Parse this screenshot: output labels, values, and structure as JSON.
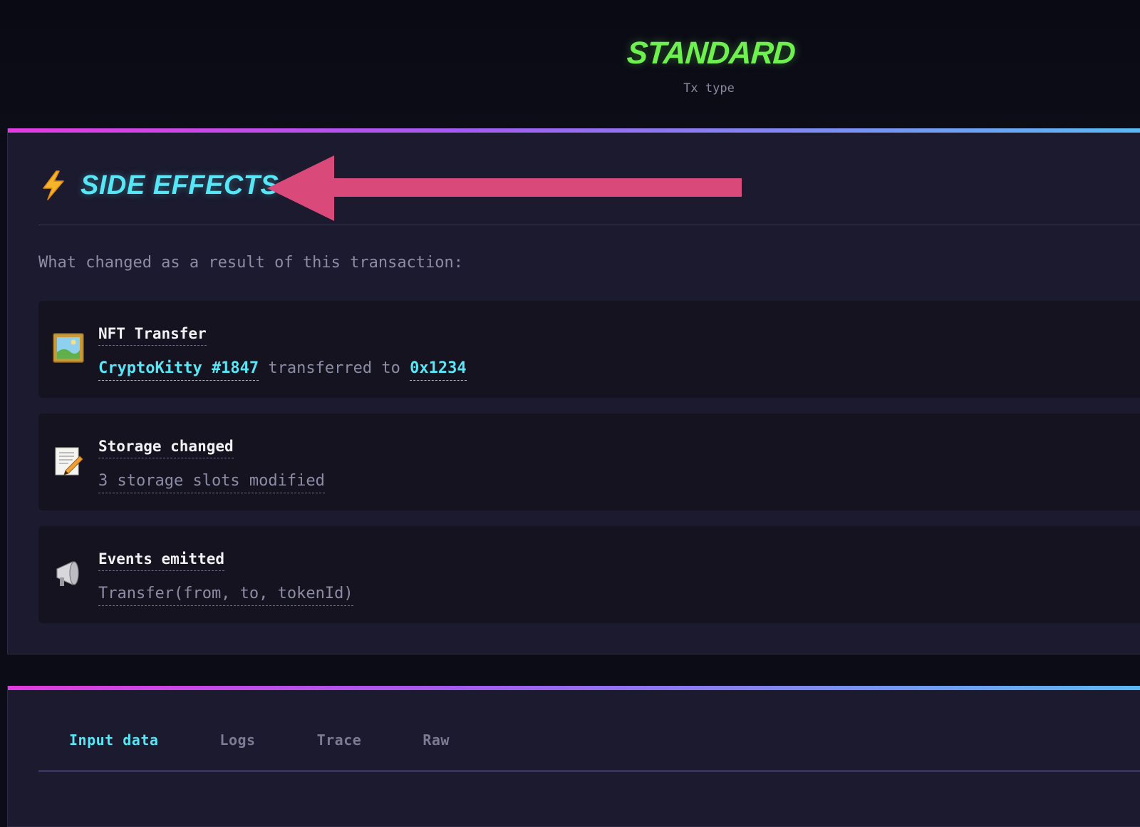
{
  "header": {
    "tx_type_value": "STANDARD",
    "tx_type_label": "Tx type"
  },
  "side_effects": {
    "icon": "lightning-bolt-icon",
    "title": "SIDE EFFECTS",
    "intro": "What changed as a result of this transaction:",
    "items": [
      {
        "icon": "framed-picture-icon",
        "title": "NFT Transfer",
        "token": "CryptoKitty #1847",
        "middle": "transferred to",
        "recipient": "0x1234"
      },
      {
        "icon": "memo-pencil-icon",
        "title": "Storage changed",
        "description": "3 storage slots modified"
      },
      {
        "icon": "megaphone-icon",
        "title": "Events emitted",
        "description": "Transfer(from, to, tokenId)"
      }
    ]
  },
  "tabs": {
    "items": [
      "Input data",
      "Logs",
      "Trace",
      "Raw"
    ],
    "active": "Input data"
  },
  "colors": {
    "accent_cyan": "#57e6f5",
    "accent_green": "#6ef04f",
    "annotation_arrow": "#d94a7a"
  }
}
